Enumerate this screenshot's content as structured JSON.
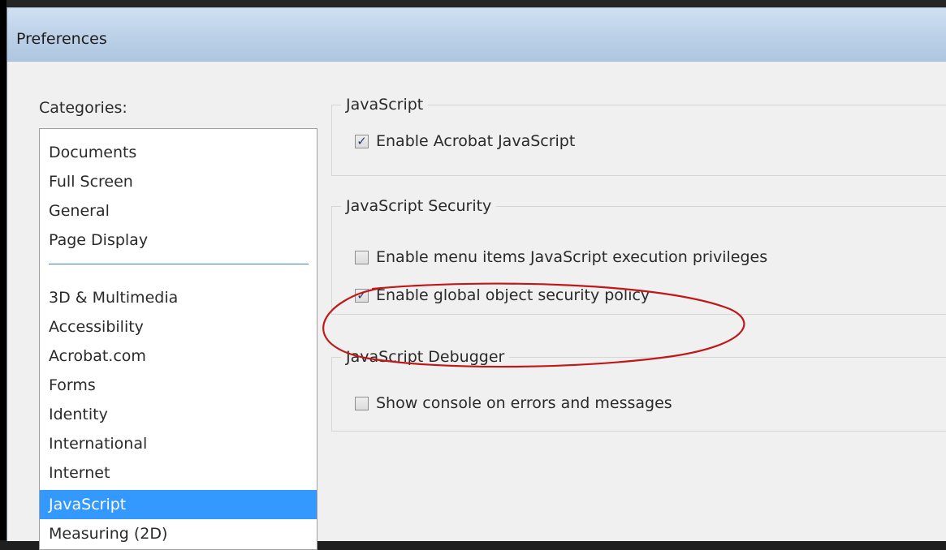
{
  "window": {
    "title": "Preferences"
  },
  "categories": {
    "label": "Categories:",
    "top_items": [
      "Documents",
      "Full Screen",
      "General",
      "Page Display"
    ],
    "items": [
      "3D & Multimedia",
      "Accessibility",
      "Acrobat.com",
      "Forms",
      "Identity",
      "International",
      "Internet",
      "JavaScript",
      "Measuring (2D)"
    ],
    "selected": "JavaScript"
  },
  "groups": [
    {
      "title": "JavaScript",
      "options": [
        {
          "label": "Enable Acrobat JavaScript",
          "checked": true
        }
      ]
    },
    {
      "title": "JavaScript Security",
      "options": [
        {
          "label": "Enable menu items JavaScript execution privileges",
          "checked": false
        },
        {
          "label": "Enable global object security policy",
          "checked": true
        }
      ]
    },
    {
      "title": "JavaScript Debugger",
      "options": [
        {
          "label": "Show console on errors and messages",
          "checked": false
        }
      ]
    }
  ],
  "colors": {
    "selection": "#3399ff",
    "annotation": "#c01818",
    "titlebar": "#bfd3e9"
  },
  "icons": {
    "checkbox_mark": "✓"
  }
}
